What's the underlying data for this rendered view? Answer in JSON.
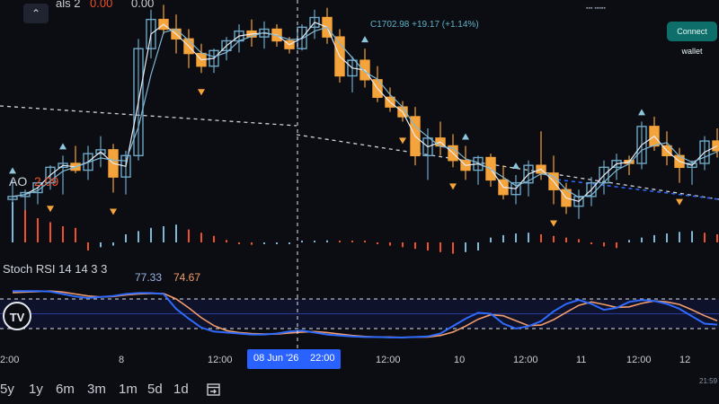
{
  "header": {
    "series_partial": "als 2",
    "change_value": "0.00",
    "change_value_2": "0.00",
    "close_info": "C1702.98 +19.17 (+1.14%)",
    "small_info": "▪▪▪ ▪▪▪▪▪",
    "collapse_icon": "chevron-up-icon",
    "connect_label": "Connect wallet"
  },
  "colors": {
    "background": "#0b0d12",
    "bull_candle": "#6fa8c7",
    "bear_candle": "#f5a33b",
    "ao_up": "#7fb8d6",
    "ao_down": "#f0502a",
    "stoch_k": "#2f6bff",
    "stoch_d": "#f39c6b",
    "accent": "#2962ff"
  },
  "ao": {
    "name": "AO",
    "value": "2.09"
  },
  "stoch": {
    "name": "Stoch RSI 14 14 3 3",
    "k": "77.33",
    "d": "74.67"
  },
  "time_axis": [
    {
      "label": "2:00"
    },
    {
      "label": "8"
    },
    {
      "label": "12:00"
    },
    {
      "label": "12:00"
    },
    {
      "label": "10"
    },
    {
      "label": "12:00"
    },
    {
      "label": "11"
    },
    {
      "label": "12:00"
    },
    {
      "label": "12"
    }
  ],
  "crosshair_time": {
    "date": "08 Jun '26",
    "time": "22:00"
  },
  "corner_time": "21:59",
  "ranges": [
    "5y",
    "1y",
    "6m",
    "3m",
    "1m",
    "5d",
    "1d"
  ],
  "logo": "TV",
  "chart_data": [
    {
      "type": "candlestick",
      "title": "",
      "candles": [
        [
          95,
          115,
          88,
          98
        ],
        [
          98,
          105,
          80,
          102
        ],
        [
          102,
          108,
          90,
          112
        ],
        [
          112,
          130,
          105,
          128
        ],
        [
          128,
          140,
          100,
          132
        ],
        [
          132,
          150,
          122,
          125
        ],
        [
          125,
          150,
          115,
          142
        ],
        [
          142,
          160,
          128,
          146
        ],
        [
          146,
          152,
          102,
          118
        ],
        [
          118,
          145,
          100,
          140
        ],
        [
          140,
          260,
          135,
          250
        ],
        [
          250,
          290,
          240,
          280
        ],
        [
          280,
          295,
          265,
          270
        ],
        [
          270,
          285,
          245,
          260
        ],
        [
          260,
          270,
          230,
          245
        ],
        [
          245,
          255,
          225,
          232
        ],
        [
          232,
          250,
          225,
          248
        ],
        [
          248,
          262,
          238,
          258
        ],
        [
          258,
          275,
          246,
          268
        ],
        [
          268,
          280,
          252,
          262
        ],
        [
          262,
          278,
          250,
          270
        ],
        [
          270,
          275,
          252,
          258
        ],
        [
          258,
          262,
          245,
          250
        ],
        [
          250,
          275,
          248,
          272
        ],
        [
          272,
          290,
          260,
          282
        ],
        [
          282,
          292,
          255,
          262
        ],
        [
          262,
          270,
          215,
          222
        ],
        [
          222,
          242,
          205,
          238
        ],
        [
          238,
          250,
          210,
          218
        ],
        [
          218,
          232,
          195,
          200
        ],
        [
          200,
          210,
          185,
          190
        ],
        [
          190,
          196,
          175,
          180
        ],
        [
          180,
          190,
          130,
          140
        ],
        [
          140,
          168,
          115,
          158
        ],
        [
          158,
          175,
          140,
          150
        ],
        [
          150,
          162,
          128,
          135
        ],
        [
          135,
          150,
          115,
          125
        ],
        [
          125,
          140,
          110,
          138
        ],
        [
          138,
          142,
          108,
          115
        ],
        [
          115,
          130,
          95,
          100
        ],
        [
          100,
          120,
          90,
          112
        ],
        [
          112,
          135,
          98,
          130
        ],
        [
          130,
          165,
          115,
          122
        ],
        [
          122,
          140,
          90,
          105
        ],
        [
          105,
          112,
          80,
          88
        ],
        [
          88,
          105,
          75,
          98
        ],
        [
          98,
          118,
          88,
          112
        ],
        [
          112,
          135,
          100,
          128
        ],
        [
          128,
          142,
          115,
          135
        ],
        [
          135,
          140,
          120,
          132
        ],
        [
          132,
          175,
          126,
          170
        ],
        [
          170,
          180,
          145,
          150
        ],
        [
          150,
          165,
          130,
          140
        ],
        [
          140,
          148,
          112,
          128
        ],
        [
          128,
          135,
          110,
          132
        ],
        [
          132,
          160,
          125,
          155
        ],
        [
          155,
          168,
          138,
          145
        ]
      ]
    },
    {
      "type": "bar",
      "title": "AO",
      "values": [
        5,
        4,
        3,
        2.5,
        2,
        1.8,
        -1,
        -0.6,
        -0.4,
        1,
        1.4,
        1.8,
        2,
        2.2,
        1.6,
        1.2,
        0.8,
        0.3,
        -0.2,
        -0.3,
        -0.2,
        -0.15,
        -0.12,
        0.15,
        0.2,
        0.25,
        0.2,
        0.15,
        0.1,
        -0.2,
        -0.4,
        -0.6,
        -0.8,
        -1,
        -1.2,
        -1.4,
        -1.2,
        -1,
        0.6,
        0.9,
        1.1,
        1.2,
        1,
        0.8,
        0.6,
        0.4,
        -0.2,
        -0.5,
        -0.7,
        0.3,
        0.6,
        0.9,
        1.1,
        1.3,
        1.4,
        1.2,
        1
      ]
    },
    {
      "type": "line",
      "title": "Stoch RSI",
      "ylim": [
        0,
        100
      ],
      "series": [
        {
          "name": "K",
          "values": [
            96,
            96,
            96,
            95,
            90,
            85,
            82,
            84,
            86,
            90,
            92,
            92,
            90,
            60,
            40,
            22,
            14,
            12,
            10,
            8,
            8,
            10,
            14,
            16,
            12,
            8,
            6,
            4,
            3,
            3,
            2,
            2,
            3,
            4,
            10,
            25,
            40,
            52,
            50,
            30,
            20,
            25,
            35,
            55,
            70,
            78,
            70,
            58,
            62,
            74,
            78,
            76,
            70,
            60,
            45,
            30,
            28
          ]
        },
        {
          "name": "D",
          "values": [
            93,
            94,
            95,
            96,
            94,
            90,
            86,
            84,
            85,
            88,
            90,
            91,
            91,
            80,
            62,
            42,
            26,
            16,
            12,
            10,
            9,
            9,
            11,
            13,
            14,
            12,
            9,
            6,
            4,
            3,
            3,
            2,
            3,
            3,
            6,
            13,
            25,
            39,
            48,
            46,
            36,
            26,
            27,
            38,
            53,
            67,
            74,
            69,
            63,
            64,
            71,
            76,
            74,
            69,
            58,
            46,
            36
          ]
        }
      ]
    }
  ]
}
